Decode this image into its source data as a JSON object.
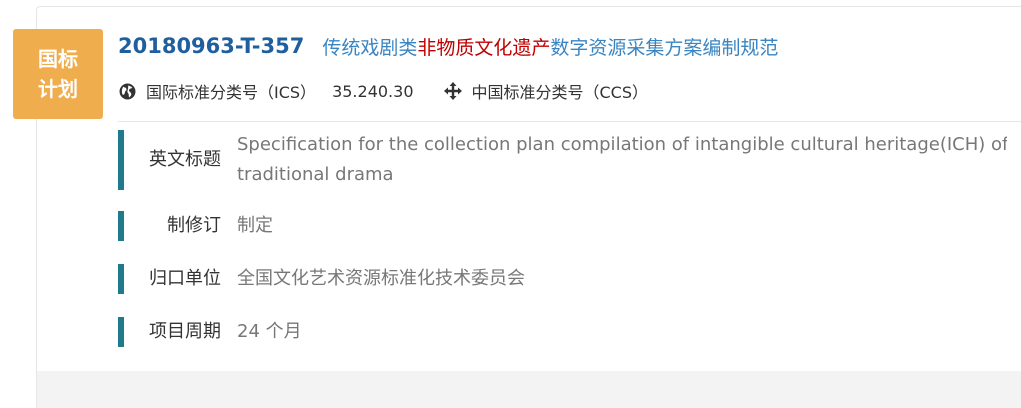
{
  "badge": {
    "line1": "国标",
    "line2": "计划",
    "color": "#f0ad4e"
  },
  "standard": {
    "code": "20180963-T-357",
    "name_pre": "传统戏剧类",
    "name_highlight": "非物质文化遗产",
    "name_post": "数字资源采集方案编制规范",
    "code_color": "#1f5f9e",
    "name_color": "#3a85c1",
    "highlight_color": "#c00000"
  },
  "meta": {
    "ics_icon": "globe-icon",
    "ics_label": "国际标准分类号（ICS）",
    "ics_value": "35.240.30",
    "ccs_icon": "move-arrows-icon",
    "ccs_label": "中国标准分类号（CCS）"
  },
  "fields": {
    "english_title_label": "英文标题",
    "english_title_line1": "Specification for the collection plan compilation of intangible cultural heritage(ICH) of",
    "english_title_line2": "traditional drama",
    "revision_label": "制修订",
    "revision_value": "制定",
    "committee_label": "归口单位",
    "committee_value": "全国文化艺术资源标准化技术委员会",
    "period_label": "项目周期",
    "period_value": "24 个月",
    "accent_color": "#1f7a8c"
  }
}
